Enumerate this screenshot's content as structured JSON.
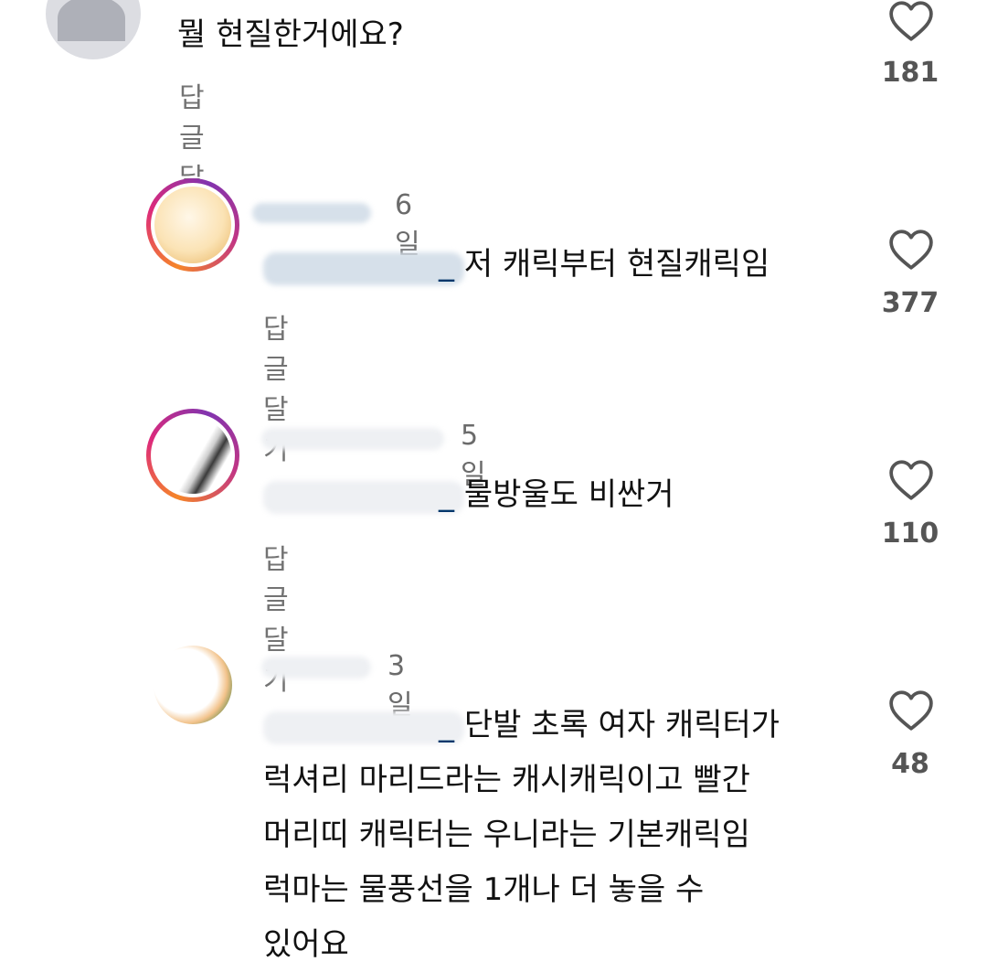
{
  "comments": [
    {
      "username": "",
      "time": "",
      "mention": "",
      "text": "뭘 현질한거에요?",
      "reply_label": "답글 달기",
      "likes": "181"
    },
    {
      "username": "",
      "time": "6일",
      "mention": "_",
      "text": "저 캐릭부터 현질캐릭임",
      "reply_label": "답글 달기",
      "likes": "377"
    },
    {
      "username": "",
      "time": "5일",
      "mention": "_",
      "text": "물방울도 비싼거",
      "reply_label": "답글 달기",
      "likes": "110"
    },
    {
      "username": "",
      "time": "3일",
      "mention": "_",
      "lines": [
        "단발 초록 여자 캐릭터가",
        "럭셔리 마리드라는 캐시캐릭이고 빨간",
        "머리띠 캐릭터는 우니라는 기본캐릭임",
        "럭마는 물풍선을 1개나 더 놓을 수",
        "있어요"
      ],
      "likes": "48"
    }
  ],
  "icons": {
    "like": "heart-outline-icon",
    "avatar_placeholder": "default-avatar-icon"
  },
  "colors": {
    "mention": "#00376b",
    "secondary_text": "#737373",
    "story_ring": "#dd2a7b"
  }
}
